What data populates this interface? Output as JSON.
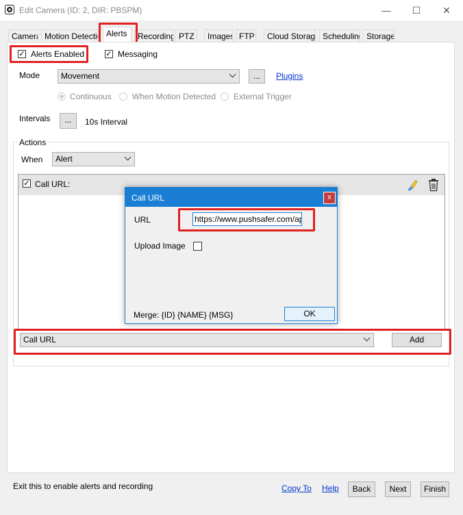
{
  "window": {
    "title": "Edit Camera (ID: 2, DIR: PBSPM)",
    "minimize_glyph": "—",
    "maximize_glyph": "☐",
    "close_glyph": "✕"
  },
  "tabs": [
    {
      "label": "Camera"
    },
    {
      "label": "Motion Detection"
    },
    {
      "label": "Alerts"
    },
    {
      "label": "Recording"
    },
    {
      "label": "PTZ"
    },
    {
      "label": "Images"
    },
    {
      "label": "FTP"
    },
    {
      "label": "Cloud Storage"
    },
    {
      "label": "Scheduling"
    },
    {
      "label": "Storage"
    }
  ],
  "alerts": {
    "alerts_enabled_label": "Alerts Enabled",
    "messaging_label": "Messaging",
    "mode_label": "Mode",
    "mode_value": "Movement",
    "ellipsis": "...",
    "plugins_link": "Plugins",
    "radio_continuous": "Continuous",
    "radio_when_motion": "When Motion Detected",
    "radio_external": "External Trigger",
    "intervals_label": "Intervals",
    "interval_value": "10s Interval"
  },
  "actions": {
    "group_label": "Actions",
    "when_label": "When",
    "when_value": "Alert",
    "action_item_label": "Call URL:",
    "add_select_value": "Call URL",
    "add_button": "Add"
  },
  "dialog": {
    "title": "Call URL",
    "close_glyph": "x",
    "url_label": "URL",
    "url_value": "https://www.pushsafer.com/api?",
    "upload_image_label": "Upload Image",
    "merge_text": "Merge: {ID} {NAME} {MSG}",
    "ok_button": "OK"
  },
  "footer": {
    "hint": "Exit this to enable alerts and recording",
    "copy_to": "Copy To",
    "help": "Help",
    "back": "Back",
    "next": "Next",
    "finish": "Finish"
  },
  "colors": {
    "highlight": "#e01f1f",
    "dialog_accent": "#1a7fd4",
    "link": "#0033cc"
  }
}
